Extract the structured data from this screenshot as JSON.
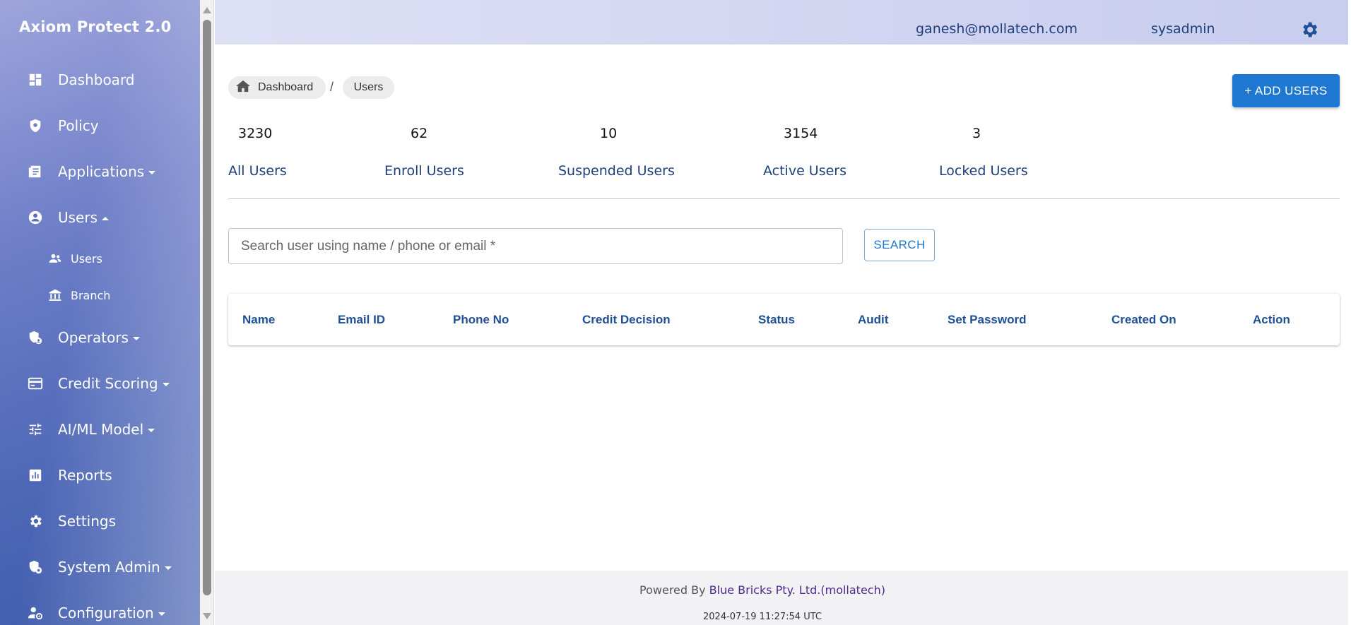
{
  "app": {
    "title": "Axiom Protect 2.0"
  },
  "sidebar": {
    "items": [
      {
        "label": "Dashboard",
        "icon": "dashboard-icon",
        "caret": ""
      },
      {
        "label": "Policy",
        "icon": "shield-icon",
        "caret": ""
      },
      {
        "label": "Applications",
        "icon": "document-list-icon",
        "caret": "down"
      },
      {
        "label": "Users",
        "icon": "account-circle-icon",
        "caret": "up"
      },
      {
        "label": "Operators",
        "icon": "security-user-icon",
        "caret": "down"
      },
      {
        "label": "Credit Scoring",
        "icon": "credit-card-icon",
        "caret": "down"
      },
      {
        "label": "AI/ML Model",
        "icon": "tune-sliders-icon",
        "caret": "down"
      },
      {
        "label": "Reports",
        "icon": "bar-chart-icon",
        "caret": ""
      },
      {
        "label": "Settings",
        "icon": "gear-icon",
        "caret": ""
      },
      {
        "label": "System Admin",
        "icon": "admin-shield-icon",
        "caret": "down"
      },
      {
        "label": "Configuration",
        "icon": "user-settings-icon",
        "caret": "down"
      }
    ],
    "sub_items": [
      {
        "label": "Users",
        "icon": "people-icon"
      },
      {
        "label": "Branch",
        "icon": "bank-icon"
      }
    ]
  },
  "header": {
    "email": "ganesh@mollatech.com",
    "role": "sysadmin",
    "settings_icon": "gear-icon"
  },
  "breadcrumb": {
    "home": "Dashboard",
    "separator": "/",
    "current": "Users"
  },
  "actions": {
    "add_users": "+ ADD USERS"
  },
  "stats": [
    {
      "count": "3230",
      "label": "All Users"
    },
    {
      "count": "62",
      "label": "Enroll Users"
    },
    {
      "count": "10",
      "label": "Suspended Users"
    },
    {
      "count": "3154",
      "label": "Active Users"
    },
    {
      "count": "3",
      "label": "Locked Users"
    }
  ],
  "search": {
    "placeholder": "Search user using name / phone or email *",
    "button": "SEARCH"
  },
  "table": {
    "columns": [
      "Name",
      "Email ID",
      "Phone No",
      "Credit Decision",
      "Status",
      "Audit",
      "Set Password",
      "Created On",
      "Action"
    ]
  },
  "footer": {
    "powered_prefix": "Powered By ",
    "company": "Blue Bricks Pty. Ltd.(mollatech)",
    "timestamp": "2024-07-19 11:27:54 UTC"
  },
  "colors": {
    "primary": "#1e78d2",
    "link_text": "#1f3f7a",
    "table_header": "#1f4f96",
    "sidebar_gradient": [
      "#9ea5dc",
      "#3e5aab"
    ]
  }
}
